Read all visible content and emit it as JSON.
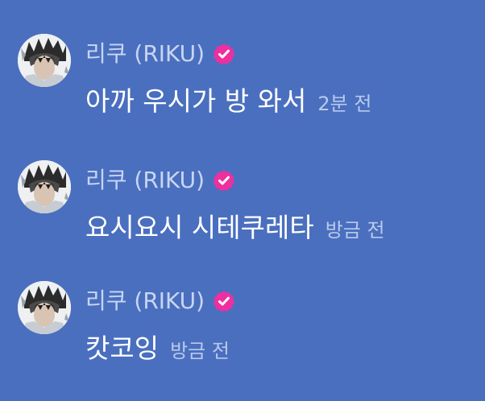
{
  "colors": {
    "background": "#4a6fbf",
    "name_text": "#c9d6f2",
    "message_text": "#ffffff",
    "time_text": "#b9c9ec",
    "verified_badge": "#ee2fa0"
  },
  "messages": [
    {
      "sender": "리쿠 (RIKU)",
      "verified_icon": "verified-badge-icon",
      "text": "아까 우시가 방 와서",
      "time": "2분 전"
    },
    {
      "sender": "리쿠 (RIKU)",
      "verified_icon": "verified-badge-icon",
      "text": "요시요시 시테쿠레타",
      "time": "방금 전"
    },
    {
      "sender": "리쿠 (RIKU)",
      "verified_icon": "verified-badge-icon",
      "text": "캇코잉",
      "time": "방금 전"
    }
  ]
}
